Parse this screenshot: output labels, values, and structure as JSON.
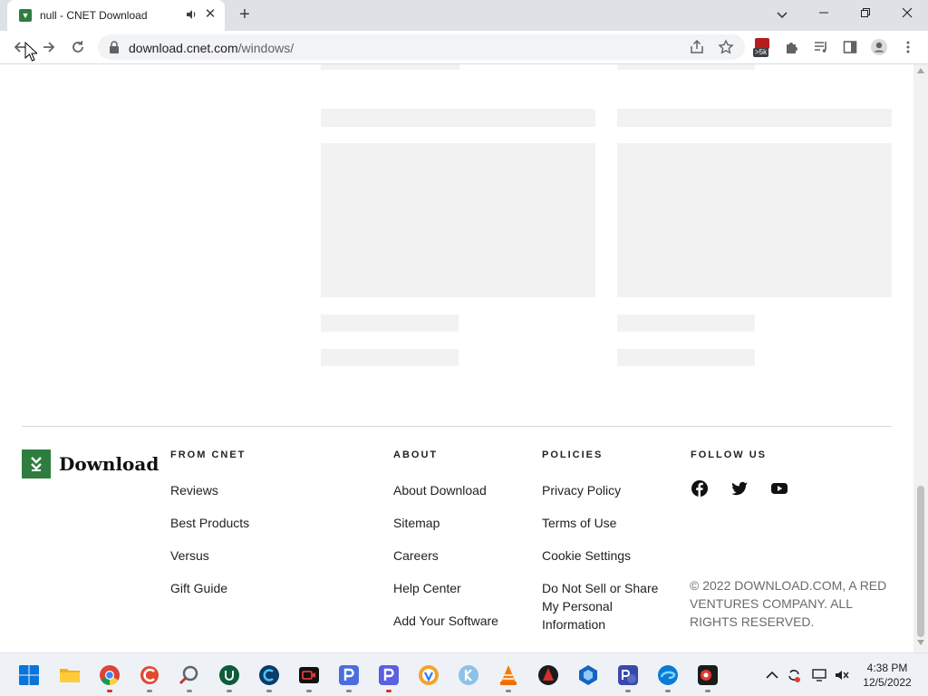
{
  "browser": {
    "tab_title": "null - CNET Download",
    "new_tab_symbol": "+",
    "close_symbol": "✕",
    "url_domain": "download.cnet.com",
    "url_path": "/windows/",
    "extension_badge": ">5k"
  },
  "footer": {
    "logo_text": "Download",
    "columns": [
      {
        "heading": "FROM CNET",
        "links": [
          "Reviews",
          "Best Products",
          "Versus",
          "Gift Guide"
        ]
      },
      {
        "heading": "ABOUT",
        "links": [
          "About Download",
          "Sitemap",
          "Careers",
          "Help Center",
          "Add Your Software"
        ]
      },
      {
        "heading": "POLICIES",
        "links": [
          "Privacy Policy",
          "Terms of Use",
          "Cookie Settings",
          "Do Not Sell or Share My Personal Information"
        ]
      },
      {
        "heading": "FOLLOW US",
        "links": []
      }
    ],
    "social": [
      "facebook-icon",
      "twitter-icon",
      "youtube-icon"
    ],
    "copyright": "© 2022 DOWNLOAD.COM, A RED VENTURES COMPANY. ALL RIGHTS RESERVED."
  },
  "taskbar": {
    "time": "4:38 PM",
    "date": "12/5/2022",
    "apps": [
      "start-icon",
      "file-explorer-icon",
      "chrome-icon",
      "ccleaner-icon",
      "search-tool-icon",
      "upwork-icon",
      "c-app-icon",
      "screen-recorder-icon",
      "p-app-icon",
      "p-app-2-icon",
      "browser-icon",
      "k-app-icon",
      "vlc-icon",
      "red-app-icon",
      "blue-app-icon",
      "ps-app-icon",
      "edge-icon",
      "record-icon"
    ]
  },
  "colors": {
    "brand_green": "#2e7d3f",
    "skeleton": "#f2f2f2",
    "chrome_bg": "#dee1e6"
  }
}
